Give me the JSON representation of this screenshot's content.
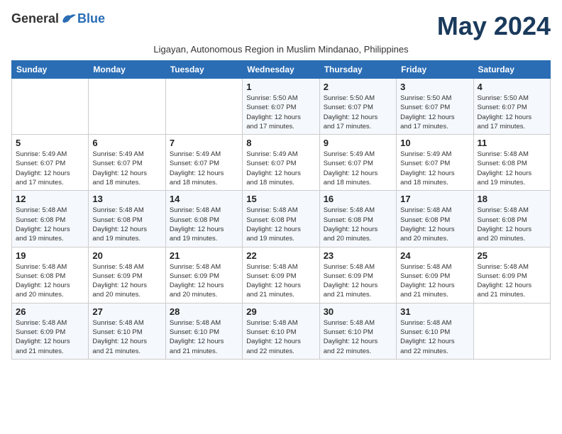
{
  "header": {
    "logo_general": "General",
    "logo_blue": "Blue",
    "month_title": "May 2024",
    "subtitle": "Ligayan, Autonomous Region in Muslim Mindanao, Philippines"
  },
  "days_of_week": [
    "Sunday",
    "Monday",
    "Tuesday",
    "Wednesday",
    "Thursday",
    "Friday",
    "Saturday"
  ],
  "weeks": [
    [
      {
        "num": "",
        "info": ""
      },
      {
        "num": "",
        "info": ""
      },
      {
        "num": "",
        "info": ""
      },
      {
        "num": "1",
        "info": "Sunrise: 5:50 AM\nSunset: 6:07 PM\nDaylight: 12 hours\nand 17 minutes."
      },
      {
        "num": "2",
        "info": "Sunrise: 5:50 AM\nSunset: 6:07 PM\nDaylight: 12 hours\nand 17 minutes."
      },
      {
        "num": "3",
        "info": "Sunrise: 5:50 AM\nSunset: 6:07 PM\nDaylight: 12 hours\nand 17 minutes."
      },
      {
        "num": "4",
        "info": "Sunrise: 5:50 AM\nSunset: 6:07 PM\nDaylight: 12 hours\nand 17 minutes."
      }
    ],
    [
      {
        "num": "5",
        "info": "Sunrise: 5:49 AM\nSunset: 6:07 PM\nDaylight: 12 hours\nand 17 minutes."
      },
      {
        "num": "6",
        "info": "Sunrise: 5:49 AM\nSunset: 6:07 PM\nDaylight: 12 hours\nand 18 minutes."
      },
      {
        "num": "7",
        "info": "Sunrise: 5:49 AM\nSunset: 6:07 PM\nDaylight: 12 hours\nand 18 minutes."
      },
      {
        "num": "8",
        "info": "Sunrise: 5:49 AM\nSunset: 6:07 PM\nDaylight: 12 hours\nand 18 minutes."
      },
      {
        "num": "9",
        "info": "Sunrise: 5:49 AM\nSunset: 6:07 PM\nDaylight: 12 hours\nand 18 minutes."
      },
      {
        "num": "10",
        "info": "Sunrise: 5:49 AM\nSunset: 6:07 PM\nDaylight: 12 hours\nand 18 minutes."
      },
      {
        "num": "11",
        "info": "Sunrise: 5:48 AM\nSunset: 6:08 PM\nDaylight: 12 hours\nand 19 minutes."
      }
    ],
    [
      {
        "num": "12",
        "info": "Sunrise: 5:48 AM\nSunset: 6:08 PM\nDaylight: 12 hours\nand 19 minutes."
      },
      {
        "num": "13",
        "info": "Sunrise: 5:48 AM\nSunset: 6:08 PM\nDaylight: 12 hours\nand 19 minutes."
      },
      {
        "num": "14",
        "info": "Sunrise: 5:48 AM\nSunset: 6:08 PM\nDaylight: 12 hours\nand 19 minutes."
      },
      {
        "num": "15",
        "info": "Sunrise: 5:48 AM\nSunset: 6:08 PM\nDaylight: 12 hours\nand 19 minutes."
      },
      {
        "num": "16",
        "info": "Sunrise: 5:48 AM\nSunset: 6:08 PM\nDaylight: 12 hours\nand 20 minutes."
      },
      {
        "num": "17",
        "info": "Sunrise: 5:48 AM\nSunset: 6:08 PM\nDaylight: 12 hours\nand 20 minutes."
      },
      {
        "num": "18",
        "info": "Sunrise: 5:48 AM\nSunset: 6:08 PM\nDaylight: 12 hours\nand 20 minutes."
      }
    ],
    [
      {
        "num": "19",
        "info": "Sunrise: 5:48 AM\nSunset: 6:08 PM\nDaylight: 12 hours\nand 20 minutes."
      },
      {
        "num": "20",
        "info": "Sunrise: 5:48 AM\nSunset: 6:09 PM\nDaylight: 12 hours\nand 20 minutes."
      },
      {
        "num": "21",
        "info": "Sunrise: 5:48 AM\nSunset: 6:09 PM\nDaylight: 12 hours\nand 20 minutes."
      },
      {
        "num": "22",
        "info": "Sunrise: 5:48 AM\nSunset: 6:09 PM\nDaylight: 12 hours\nand 21 minutes."
      },
      {
        "num": "23",
        "info": "Sunrise: 5:48 AM\nSunset: 6:09 PM\nDaylight: 12 hours\nand 21 minutes."
      },
      {
        "num": "24",
        "info": "Sunrise: 5:48 AM\nSunset: 6:09 PM\nDaylight: 12 hours\nand 21 minutes."
      },
      {
        "num": "25",
        "info": "Sunrise: 5:48 AM\nSunset: 6:09 PM\nDaylight: 12 hours\nand 21 minutes."
      }
    ],
    [
      {
        "num": "26",
        "info": "Sunrise: 5:48 AM\nSunset: 6:09 PM\nDaylight: 12 hours\nand 21 minutes."
      },
      {
        "num": "27",
        "info": "Sunrise: 5:48 AM\nSunset: 6:10 PM\nDaylight: 12 hours\nand 21 minutes."
      },
      {
        "num": "28",
        "info": "Sunrise: 5:48 AM\nSunset: 6:10 PM\nDaylight: 12 hours\nand 21 minutes."
      },
      {
        "num": "29",
        "info": "Sunrise: 5:48 AM\nSunset: 6:10 PM\nDaylight: 12 hours\nand 22 minutes."
      },
      {
        "num": "30",
        "info": "Sunrise: 5:48 AM\nSunset: 6:10 PM\nDaylight: 12 hours\nand 22 minutes."
      },
      {
        "num": "31",
        "info": "Sunrise: 5:48 AM\nSunset: 6:10 PM\nDaylight: 12 hours\nand 22 minutes."
      },
      {
        "num": "",
        "info": ""
      }
    ]
  ]
}
